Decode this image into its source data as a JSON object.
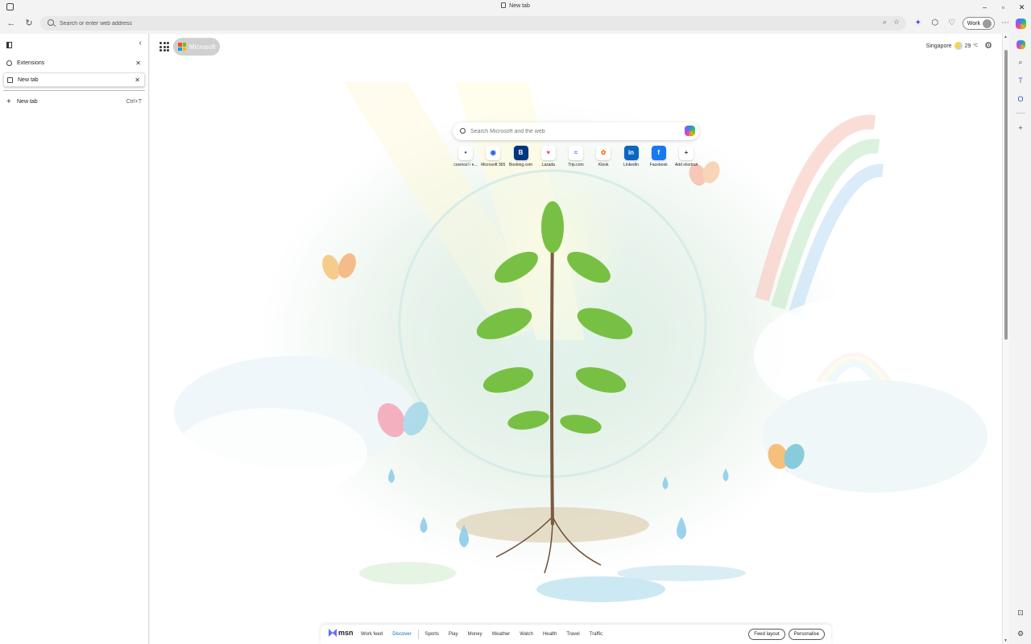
{
  "window": {
    "tab_title": "New tab"
  },
  "window_controls": {
    "minimize": "–",
    "restore": "▫",
    "close": "✕"
  },
  "toolbar": {
    "address_placeholder": "Search or enter web address",
    "profile_label": "Work"
  },
  "sidebar": {
    "tabs": [
      {
        "label": "Extensions",
        "icon": "extensions-icon",
        "active": false
      },
      {
        "label": "New tab",
        "icon": "page-icon",
        "active": true
      }
    ],
    "new_tab_label": "New tab",
    "new_tab_shortcut": "Ctrl+T"
  },
  "newtab": {
    "brand_label": "Microsoft",
    "weather": {
      "location": "Singapore",
      "temp": "29",
      "unit": "°C"
    },
    "search_placeholder": "Search Microsoft and the web",
    "tiles": [
      {
        "label": "cosmos! i e...",
        "glyph": "•",
        "color": "#1e3a8a"
      },
      {
        "label": "Microsoft 365",
        "glyph": "◉",
        "color": "#2563eb"
      },
      {
        "label": "Booking.com",
        "glyph": "B",
        "color": "#ffffff",
        "bg": "#003580"
      },
      {
        "label": "Lazada",
        "glyph": "♥",
        "color": "#ec4899"
      },
      {
        "label": "Trip.com",
        "glyph": "≈",
        "color": "#3b82f6"
      },
      {
        "label": "Klook",
        "glyph": "✿",
        "color": "#f97316"
      },
      {
        "label": "LinkedIn",
        "glyph": "in",
        "color": "#ffffff",
        "bg": "#0a66c2"
      },
      {
        "label": "Facebook",
        "glyph": "f",
        "color": "#ffffff",
        "bg": "#1877f2"
      },
      {
        "label": "Add shortcut",
        "glyph": "+",
        "color": "#333333"
      }
    ]
  },
  "msn": {
    "logo_text": "msn",
    "nav": [
      "Work feed",
      "Discover",
      "Sports",
      "Play",
      "Money",
      "Weather",
      "Watch",
      "Health",
      "Travel",
      "Traffic"
    ],
    "active_index": 1,
    "feed_layout_label": "Feed layout",
    "personalise_label": "Personalise"
  },
  "colors": {
    "accent": "#0f6cbd",
    "sidebar_bg": "#ffffff",
    "chrome_bg": "#f3f3f3"
  }
}
